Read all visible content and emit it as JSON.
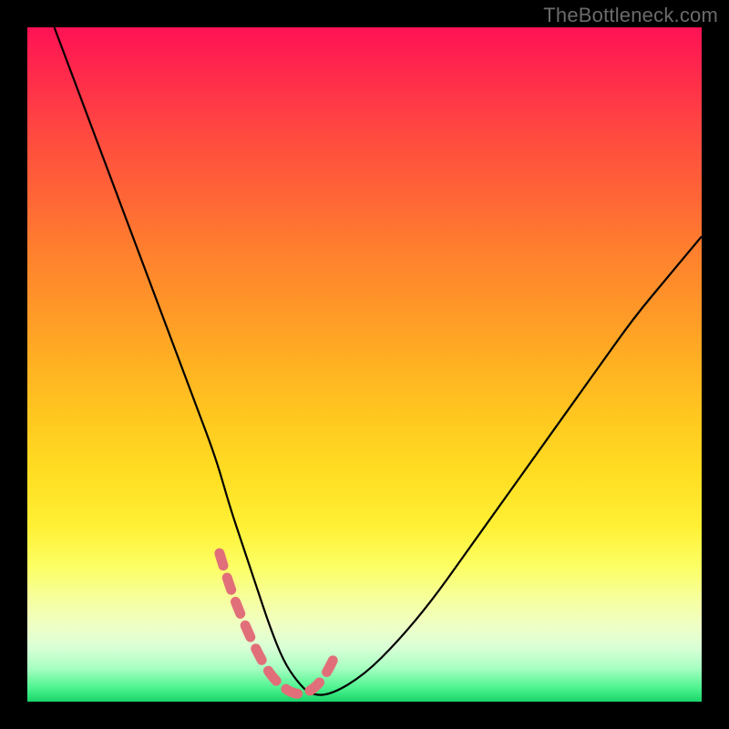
{
  "watermark": "TheBottleneck.com",
  "colors": {
    "curve_black": "#000000",
    "dash_pink": "#e16f79",
    "bg_black": "#000000"
  },
  "chart_data": {
    "type": "line",
    "title": "",
    "xlabel": "",
    "ylabel": "",
    "xlim": [
      0,
      100
    ],
    "ylim": [
      0,
      100
    ],
    "grid": false,
    "legend": false,
    "series": [
      {
        "name": "bottleneck-curve",
        "x": [
          4,
          7,
          10,
          13,
          16,
          19,
          22,
          25,
          28,
          30,
          32,
          34,
          36,
          38,
          40,
          42,
          45,
          50,
          55,
          60,
          65,
          70,
          75,
          80,
          85,
          90,
          95,
          100
        ],
        "y": [
          100,
          92,
          84,
          76,
          68,
          60,
          52,
          44,
          36,
          29,
          23,
          17,
          11,
          6,
          3,
          1,
          1,
          4,
          9,
          15,
          22,
          29,
          36,
          43,
          50,
          57,
          63,
          69
        ]
      }
    ],
    "highlight_segment": {
      "name": "valley-dashed",
      "x": [
        28.5,
        30,
        32,
        34,
        36,
        38,
        40,
        42,
        44,
        46
      ],
      "y": [
        22,
        17,
        12,
        7.5,
        4,
        2,
        1,
        1.5,
        3.5,
        7.5
      ]
    }
  }
}
